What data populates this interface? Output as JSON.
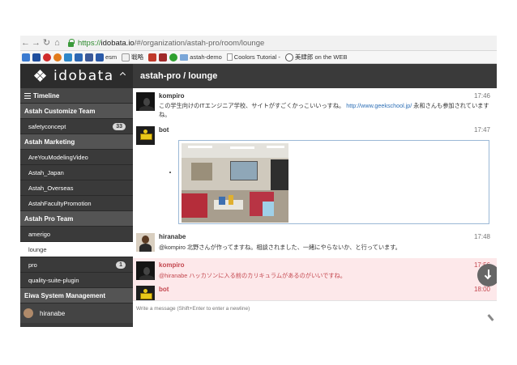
{
  "browser": {
    "url_scheme": "https://",
    "url_host": "idobata.io",
    "url_path": "/#/organization/astah-pro/room/lounge",
    "bookmarks": [
      {
        "label": "esm",
        "icon": "zeitgeist-icon",
        "color": "#2b5aa8"
      },
      {
        "label": "戦略",
        "icon": "w-icon",
        "color": "#6f6f6f"
      },
      {
        "label": "astah-demo",
        "icon": "folder-icon",
        "color": "#7aa6d8"
      },
      {
        "label": "Coolors Tutorial - ",
        "icon": "page-icon",
        "color": "#999999"
      },
      {
        "label": "美肆郎 on the WEB",
        "icon": "clock-icon",
        "color": "#555555"
      }
    ]
  },
  "app": {
    "logo_text": "idobata",
    "room_title": "astah-pro / lounge"
  },
  "sidebar": {
    "timeline_label": "Timeline",
    "organizations": [
      {
        "name": "Astah Customize Team",
        "rooms": [
          {
            "name": "safetyconcept",
            "badge": "33"
          }
        ]
      },
      {
        "name": "Astah Marketing",
        "rooms": [
          {
            "name": "AreYouModelingVideo"
          },
          {
            "name": "Astah_Japan"
          },
          {
            "name": "Astah_Overseas"
          },
          {
            "name": "AstahFacultyPromotion"
          }
        ]
      },
      {
        "name": "Astah Pro Team",
        "rooms": [
          {
            "name": "amerigo"
          },
          {
            "name": "lounge",
            "active": true
          },
          {
            "name": "pro",
            "badge": "1"
          },
          {
            "name": "quality-suite-plugin"
          }
        ]
      },
      {
        "name": "Eiwa System Management",
        "rooms": []
      }
    ],
    "user_name": "hiranabe"
  },
  "messages": [
    {
      "author": "kompiro",
      "time": "17:46",
      "text_before": "この学生向けのITエンジニア学校、サイトがすごくかっこいいっすね。 ",
      "link": "http://www.geekschool.jp/",
      "text_after": " 永和さんも参加されていますね。",
      "highlight": false
    },
    {
      "author": "bot",
      "time": "17:47",
      "text": "",
      "highlight": false
    },
    {
      "author": "hiranabe",
      "time": "17:48",
      "text": "@kompiro 北野さんが作ってますね。相談されました、一緒にやらないか、と行っています。",
      "highlight": false
    },
    {
      "author": "kompiro",
      "time": "17:56",
      "text": "@hiranabe ハッカソンに入る前のカリキュラムがあるのがいいですね。",
      "highlight": true
    },
    {
      "author": "bot",
      "time": "18:00",
      "text": "",
      "highlight": true
    }
  ],
  "composer": {
    "placeholder": "Write a message (Shift+Enter to enter a newline)"
  },
  "colors": {
    "sidebar_bg": "#3a3a3a",
    "header_bg": "#3a3a3a",
    "highlight_bg": "#fde8ea",
    "highlight_text": "#c4474f",
    "link": "#2d6fb6"
  }
}
